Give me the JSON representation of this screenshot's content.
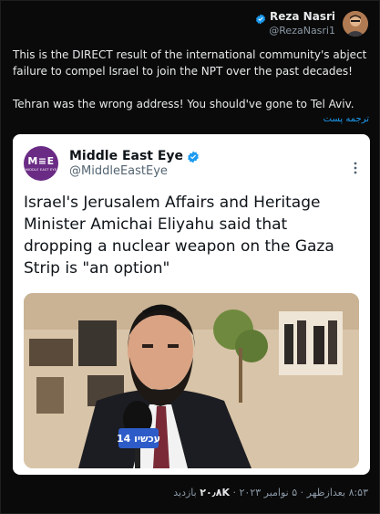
{
  "author": {
    "display_name": "Reza Nasri",
    "handle": "@RezaNasri1"
  },
  "tweet": {
    "paragraphs": [
      "This is the DIRECT result of the international community's abject failure to compel Israel to join the NPT over the past decades!",
      "Tehran was the wrong address! You should've gone to Tel Aviv."
    ],
    "translate_label": "ترجمه پست"
  },
  "quoted": {
    "logo_text": "M≡E",
    "logo_subtext": "MIDDLE EAST EYE",
    "display_name": "Middle East Eye",
    "handle": "@MiddleEastEye",
    "headline": "Israel's Jerusalem Affairs and Heritage Minister Amichai Eliyahu said that dropping a nuclear weapon on the Gaza Strip is \"an option\"",
    "mic_text": "עכשיו 14"
  },
  "meta": {
    "timestamp": "۸:۵۳ بعدازظهر · ۵ نوامبر ۲۰۲۳ ·",
    "views_count": "۲۰٫۸K",
    "views_label": "بازدید"
  },
  "colors": {
    "background": "#0a0a0a",
    "link": "#1d9bf0",
    "verified": "#1d9bf0",
    "mee_purple": "#6a2b85"
  },
  "icons": [
    "verified-badge-icon",
    "more-options-icon"
  ]
}
